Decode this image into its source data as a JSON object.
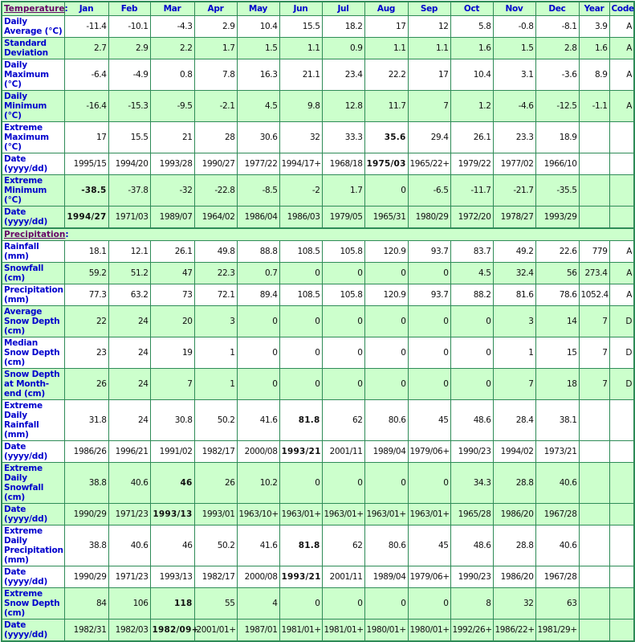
{
  "header": {
    "section_temperature": "Temperature",
    "section_precipitation": "Precipitation",
    "colon": ":",
    "months": [
      "Jan",
      "Feb",
      "Mar",
      "Apr",
      "May",
      "Jun",
      "Jul",
      "Aug",
      "Sep",
      "Oct",
      "Nov",
      "Dec"
    ],
    "year_label": "Year",
    "code_label": "Code"
  },
  "temperature_rows": [
    {
      "label": "Daily Average (°C)",
      "values": [
        "-11.4",
        "-10.1",
        "-4.3",
        "2.9",
        "10.4",
        "15.5",
        "18.2",
        "17",
        "12",
        "5.8",
        "-0.8",
        "-8.1"
      ],
      "year": "3.9",
      "code": "A",
      "bold": []
    },
    {
      "label": "Standard Deviation",
      "values": [
        "2.7",
        "2.9",
        "2.2",
        "1.7",
        "1.5",
        "1.1",
        "0.9",
        "1.1",
        "1.1",
        "1.6",
        "1.5",
        "2.8"
      ],
      "year": "1.6",
      "code": "A",
      "bold": []
    },
    {
      "label": "Daily Maximum (°C)",
      "values": [
        "-6.4",
        "-4.9",
        "0.8",
        "7.8",
        "16.3",
        "21.1",
        "23.4",
        "22.2",
        "17",
        "10.4",
        "3.1",
        "-3.6"
      ],
      "year": "8.9",
      "code": "A",
      "bold": []
    },
    {
      "label": "Daily Minimum (°C)",
      "values": [
        "-16.4",
        "-15.3",
        "-9.5",
        "-2.1",
        "4.5",
        "9.8",
        "12.8",
        "11.7",
        "7",
        "1.2",
        "-4.6",
        "-12.5"
      ],
      "year": "-1.1",
      "code": "A",
      "bold": []
    },
    {
      "label": "Extreme Maximum (°C)",
      "values": [
        "17",
        "15.5",
        "21",
        "28",
        "30.6",
        "32",
        "33.3",
        "35.6",
        "29.4",
        "26.1",
        "23.3",
        "18.9"
      ],
      "year": "",
      "code": "",
      "bold": [
        7
      ]
    },
    {
      "label": "Date (yyyy/dd)",
      "values": [
        "1995/15",
        "1994/20",
        "1993/28",
        "1990/27",
        "1977/22",
        "1994/17+",
        "1968/18",
        "1975/03",
        "1965/22+",
        "1979/22",
        "1977/02",
        "1966/10"
      ],
      "year": "",
      "code": "",
      "bold": [
        7
      ]
    },
    {
      "label": "Extreme Minimum (°C)",
      "values": [
        "-38.5",
        "-37.8",
        "-32",
        "-22.8",
        "-8.5",
        "-2",
        "1.7",
        "0",
        "-6.5",
        "-11.7",
        "-21.7",
        "-35.5"
      ],
      "year": "",
      "code": "",
      "bold": [
        0
      ]
    },
    {
      "label": "Date (yyyy/dd)",
      "values": [
        "1994/27",
        "1971/03",
        "1989/07",
        "1964/02",
        "1986/04",
        "1986/03",
        "1979/05",
        "1965/31",
        "1980/29",
        "1972/20",
        "1978/27",
        "1993/29"
      ],
      "year": "",
      "code": "",
      "bold": [
        0
      ]
    }
  ],
  "precipitation_rows": [
    {
      "label": "Rainfall (mm)",
      "values": [
        "18.1",
        "12.1",
        "26.1",
        "49.8",
        "88.8",
        "108.5",
        "105.8",
        "120.9",
        "93.7",
        "83.7",
        "49.2",
        "22.6"
      ],
      "year": "779",
      "code": "A",
      "bold": []
    },
    {
      "label": "Snowfall (cm)",
      "values": [
        "59.2",
        "51.2",
        "47",
        "22.3",
        "0.7",
        "0",
        "0",
        "0",
        "0",
        "4.5",
        "32.4",
        "56"
      ],
      "year": "273.4",
      "code": "A",
      "bold": []
    },
    {
      "label": "Precipitation (mm)",
      "values": [
        "77.3",
        "63.2",
        "73",
        "72.1",
        "89.4",
        "108.5",
        "105.8",
        "120.9",
        "93.7",
        "88.2",
        "81.6",
        "78.6"
      ],
      "year": "1052.4",
      "code": "A",
      "bold": []
    },
    {
      "label": "Average Snow Depth (cm)",
      "values": [
        "22",
        "24",
        "20",
        "3",
        "0",
        "0",
        "0",
        "0",
        "0",
        "0",
        "3",
        "14"
      ],
      "year": "7",
      "code": "D",
      "bold": []
    },
    {
      "label": "Median Snow Depth (cm)",
      "values": [
        "23",
        "24",
        "19",
        "1",
        "0",
        "0",
        "0",
        "0",
        "0",
        "0",
        "1",
        "15"
      ],
      "year": "7",
      "code": "D",
      "bold": []
    },
    {
      "label": "Snow Depth at Month-end (cm)",
      "values": [
        "26",
        "24",
        "7",
        "1",
        "0",
        "0",
        "0",
        "0",
        "0",
        "0",
        "7",
        "18"
      ],
      "year": "7",
      "code": "D",
      "bold": []
    },
    {
      "label": "Extreme Daily Rainfall (mm)",
      "values": [
        "31.8",
        "24",
        "30.8",
        "50.2",
        "41.6",
        "81.8",
        "62",
        "80.6",
        "45",
        "48.6",
        "28.4",
        "38.1"
      ],
      "year": "",
      "code": "",
      "bold": [
        5
      ]
    },
    {
      "label": "Date (yyyy/dd)",
      "values": [
        "1986/26",
        "1996/21",
        "1991/02",
        "1982/17",
        "2000/08",
        "1993/21",
        "2001/11",
        "1989/04",
        "1979/06+",
        "1990/23",
        "1994/02",
        "1973/21"
      ],
      "year": "",
      "code": "",
      "bold": [
        5
      ]
    },
    {
      "label": "Extreme Daily Snowfall (cm)",
      "values": [
        "38.8",
        "40.6",
        "46",
        "26",
        "10.2",
        "0",
        "0",
        "0",
        "0",
        "34.3",
        "28.8",
        "40.6"
      ],
      "year": "",
      "code": "",
      "bold": [
        2
      ]
    },
    {
      "label": "Date (yyyy/dd)",
      "values": [
        "1990/29",
        "1971/23",
        "1993/13",
        "1993/01",
        "1963/10+",
        "1963/01+",
        "1963/01+",
        "1963/01+",
        "1963/01+",
        "1965/28",
        "1986/20",
        "1967/28"
      ],
      "year": "",
      "code": "",
      "bold": [
        2
      ]
    },
    {
      "label": "Extreme Daily Precipitation (mm)",
      "values": [
        "38.8",
        "40.6",
        "46",
        "50.2",
        "41.6",
        "81.8",
        "62",
        "80.6",
        "45",
        "48.6",
        "28.8",
        "40.6"
      ],
      "year": "",
      "code": "",
      "bold": [
        5
      ]
    },
    {
      "label": "Date (yyyy/dd)",
      "values": [
        "1990/29",
        "1971/23",
        "1993/13",
        "1982/17",
        "2000/08",
        "1993/21",
        "2001/11",
        "1989/04",
        "1979/06+",
        "1990/23",
        "1986/20",
        "1967/28"
      ],
      "year": "",
      "code": "",
      "bold": [
        5
      ]
    },
    {
      "label": "Extreme Snow Depth (cm)",
      "values": [
        "84",
        "106",
        "118",
        "55",
        "4",
        "0",
        "0",
        "0",
        "0",
        "8",
        "32",
        "63"
      ],
      "year": "",
      "code": "",
      "bold": [
        2
      ]
    },
    {
      "label": "Date (yyyy/dd)",
      "values": [
        "1982/31",
        "1982/03",
        "1982/09+",
        "2001/01+",
        "1987/01",
        "1981/01+",
        "1981/01+",
        "1980/01+",
        "1980/01+",
        "1992/26+",
        "1986/22+",
        "1981/29+"
      ],
      "year": "",
      "code": "",
      "bold": [
        2
      ]
    }
  ],
  "colors": {
    "border": "#2e8b57",
    "shaded_row": "#ccffcc",
    "label_text": "#0000cc",
    "section_link": "#660066"
  }
}
